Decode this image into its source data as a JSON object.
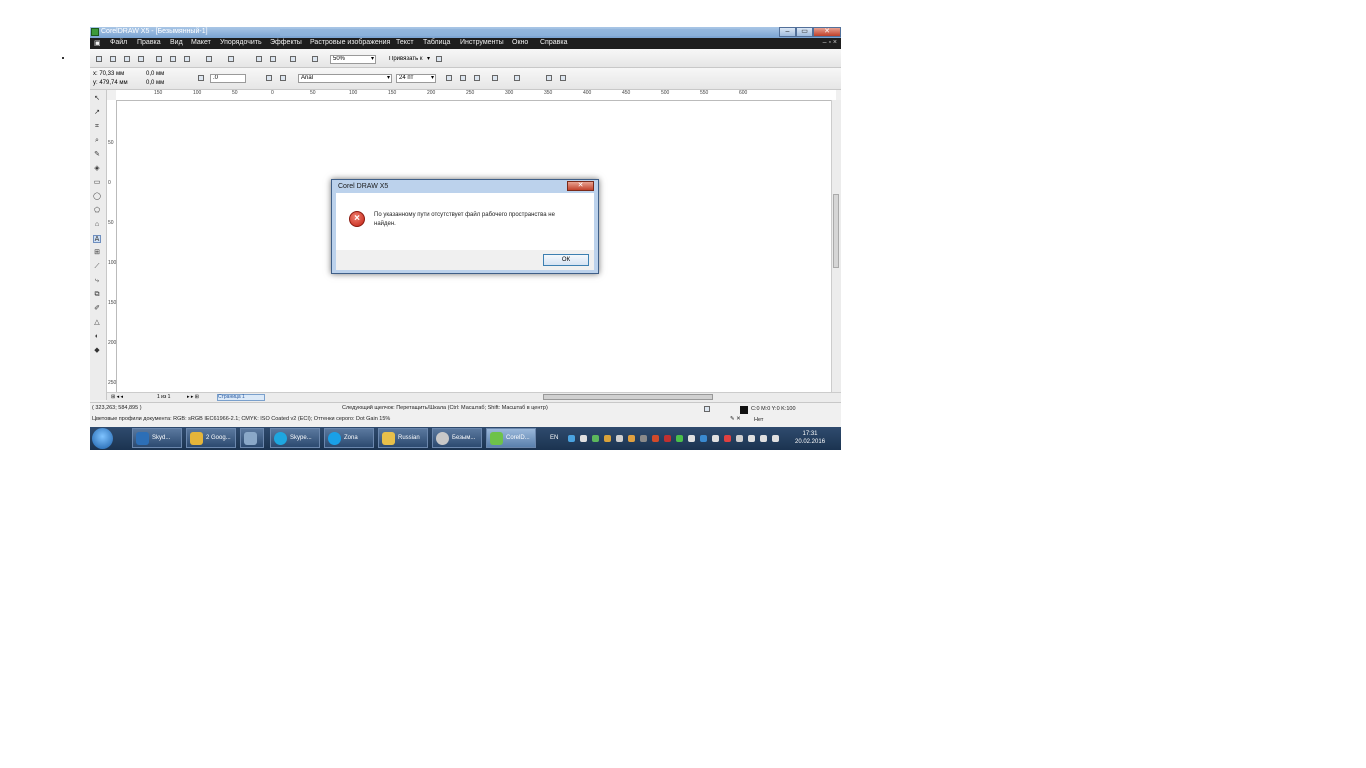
{
  "window": {
    "title": "CorelDRAW X5 - [Безымянный-1]",
    "controls": {
      "minimize": "–",
      "restore": "▭",
      "close": "✕"
    }
  },
  "menu": {
    "items": [
      "Файл",
      "Правка",
      "Вид",
      "Макет",
      "Упорядочить",
      "Эффекты",
      "Растровые изображения",
      "Текст",
      "Таблица",
      "Инструменты",
      "Окно",
      "Справка"
    ],
    "right": "– ▫ ×"
  },
  "toolbar": {
    "zoom": "50%",
    "snap": "Привязать к"
  },
  "property_bar": {
    "x": "x: 70,33 мм",
    "y": "y: 479,74 мм",
    "w": "0,0 мм",
    "h": "0,0 мм",
    "angle": ".0",
    "font": "Arial",
    "size": "24 пт"
  },
  "ruler": {
    "h_marks": [
      "150",
      "100",
      "50",
      "0",
      "50",
      "100",
      "150",
      "200",
      "250",
      "300",
      "350",
      "400",
      "450",
      "500",
      "550",
      "600"
    ],
    "v_marks": [
      "50",
      "0",
      "50",
      "100",
      "150",
      "200",
      "250"
    ]
  },
  "page_bar": {
    "page_count": "1 из 1",
    "page_tab": "Страница 1"
  },
  "status": {
    "coords": "( 323,263; 584,895 )",
    "hint": "Следующий щелчок: Перетащить/Шкала (Ctrl: Масштаб; Shift: Масштаб в центр)",
    "color_profile": "Цветовые профили документа: RGB: sRGB IEC61966-2.1; CMYK: ISO Coated v2 (ECI); Оттенки серого: Dot Gain 15%",
    "fill": "C:0 M:0 Y:0 K:100",
    "outline": "Нет"
  },
  "taskbar": {
    "buttons": [
      {
        "label": "Skyd...",
        "color": "#2d6fb7"
      },
      {
        "label": "2 Goog...",
        "color": "#e5b53a"
      },
      {
        "label": "",
        "color": "#8aa8c8"
      },
      {
        "label": "Skype...",
        "color": "#1ea7e0"
      },
      {
        "label": "Zona",
        "color": "#19a0e8"
      },
      {
        "label": "Russian",
        "color": "#e8c04a"
      },
      {
        "label": "Безым...",
        "color": "#c8c8c8"
      },
      {
        "label": "CorelD...",
        "color": "#6ec24a"
      }
    ],
    "lang": "EN",
    "time": "17:31",
    "date": "20.02.2016"
  },
  "dialog": {
    "title": "Corel DRAW X5",
    "message": "По указанному пути отсутствует файл рабочего пространства не найден.",
    "ok": "ОК",
    "close": "✕"
  },
  "colors": {
    "titlebar": "#7aa3d2",
    "menubar": "#1e1e1e",
    "taskbar": "#1b3350",
    "error": "#c21f12"
  }
}
